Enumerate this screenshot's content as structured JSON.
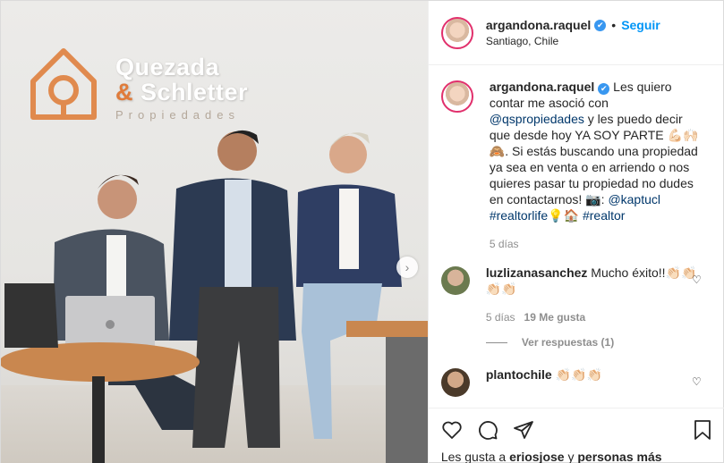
{
  "post": {
    "brand": {
      "line1": "Quezada",
      "line2_amp": "&",
      "line2": " Schletter",
      "line3": "Propiedades"
    }
  },
  "header": {
    "username": "argandona.raquel",
    "verified": "✔",
    "dot": "•",
    "follow_label": "Seguir",
    "location": "Santiago, Chile",
    "more": "···"
  },
  "caption": {
    "username": "argandona.raquel",
    "verified": "✔",
    "text1": " Les quiero contar me asoció con ",
    "mention1": "@qspropiedades",
    "text2": " y les puedo decir que desde hoy YA SOY PARTE 💪🏻🙌🏻🙈. Si estás buscando una propiedad ya sea en venta o en arriendo o nos quieres pasar tu propiedad no dudes en contactarnos! 📷: ",
    "mention2": "@kaptucl",
    "tag1": "#realtorlife",
    "mid": "💡🏠 ",
    "tag2": "#realtor",
    "time": "5 días"
  },
  "comments": [
    {
      "username": "luzlizanasanchez",
      "text": " Mucho éxito!!👏🏻👏🏻👏🏻👏🏻",
      "time": "5 días",
      "likes": "19 Me gusta",
      "replies": "Ver respuestas (1)"
    },
    {
      "username": "plantochile",
      "text": " 👏🏻👏🏻👏🏻"
    }
  ],
  "footer": {
    "likes_prefix": "Les gusta a ",
    "user": "eriosjose",
    "mid": " y ",
    "others": "personas más"
  },
  "colors": {
    "accent": "#0095f6",
    "ring": "#e1306c"
  }
}
